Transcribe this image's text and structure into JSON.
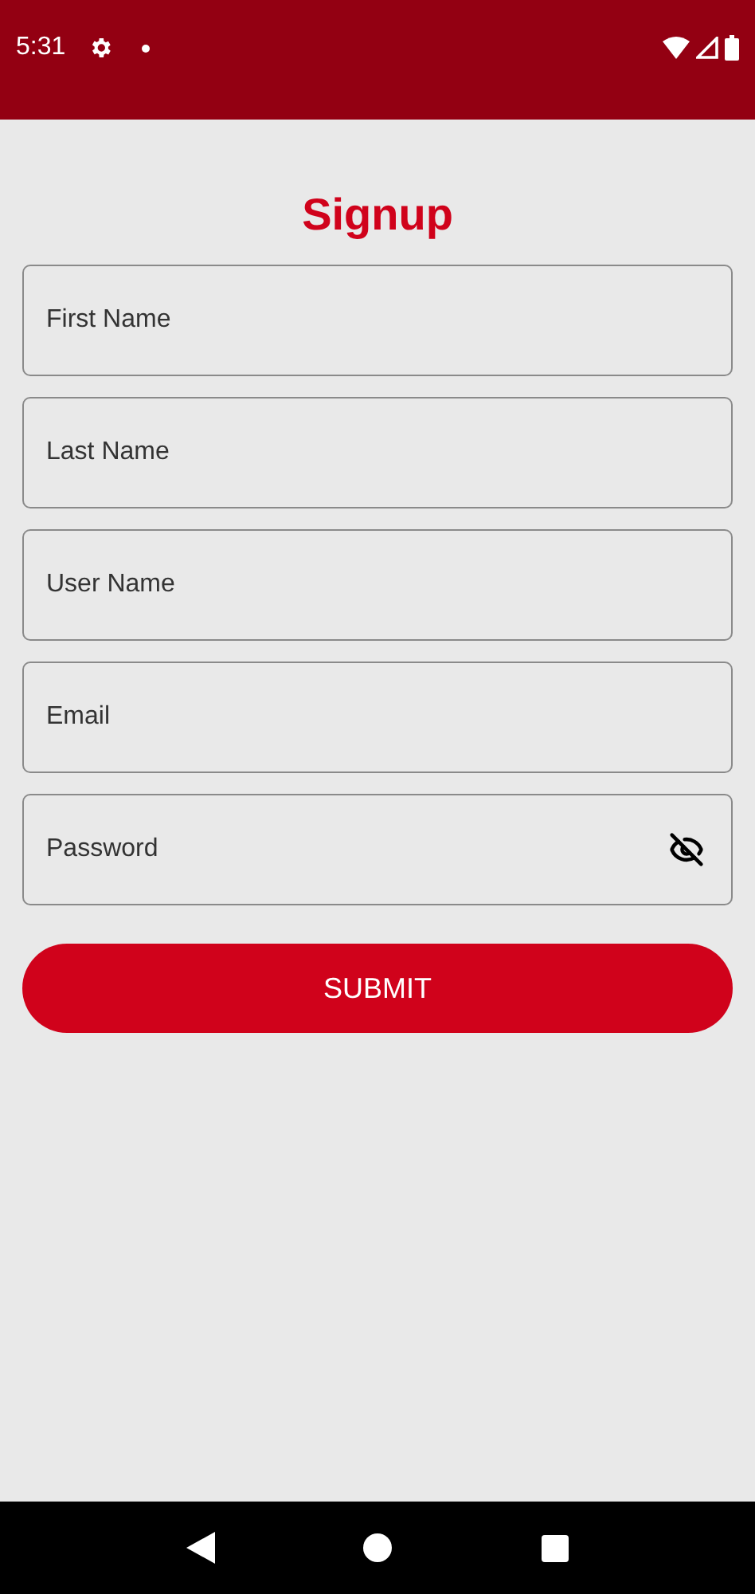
{
  "status_bar": {
    "time": "5:31"
  },
  "title": "Signup",
  "fields": [
    {
      "placeholder": "First Name",
      "kind": "text"
    },
    {
      "placeholder": "Last Name",
      "kind": "text"
    },
    {
      "placeholder": "User Name",
      "kind": "text"
    },
    {
      "placeholder": "Email",
      "kind": "text"
    },
    {
      "placeholder": "Password",
      "kind": "password"
    }
  ],
  "submit": "SUBMIT"
}
